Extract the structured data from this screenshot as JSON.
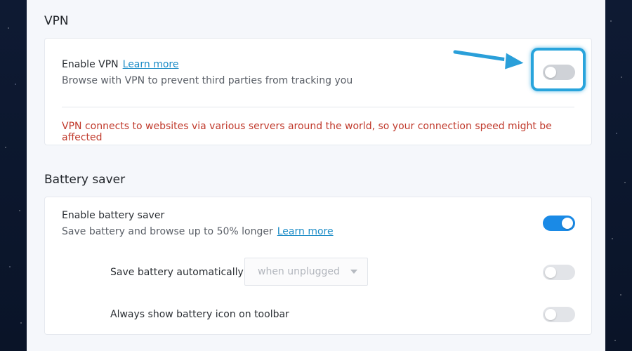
{
  "vpn": {
    "section_title": "VPN",
    "enable_label": "Enable VPN",
    "learn_more": "Learn more",
    "description": "Browse with VPN to prevent third parties from tracking you",
    "warning": "VPN connects to websites via various servers around the world, so your connection speed might be affected",
    "enabled": false
  },
  "battery": {
    "section_title": "Battery saver",
    "enable_label": "Enable battery saver",
    "description": "Save battery and browse up to 50% longer",
    "learn_more": "Learn more",
    "enabled": true,
    "auto_label": "Save battery automatically",
    "auto_select_value": "when unplugged",
    "auto_enabled": false,
    "icon_label": "Always show battery icon on toolbar",
    "icon_enabled": false
  },
  "colors": {
    "accent": "#1a8ae6",
    "link": "#1a8bc6",
    "warning": "#c0392b",
    "highlight": "#28a4dc"
  },
  "annotation": {
    "icon": "arrow-pointer-icon"
  }
}
